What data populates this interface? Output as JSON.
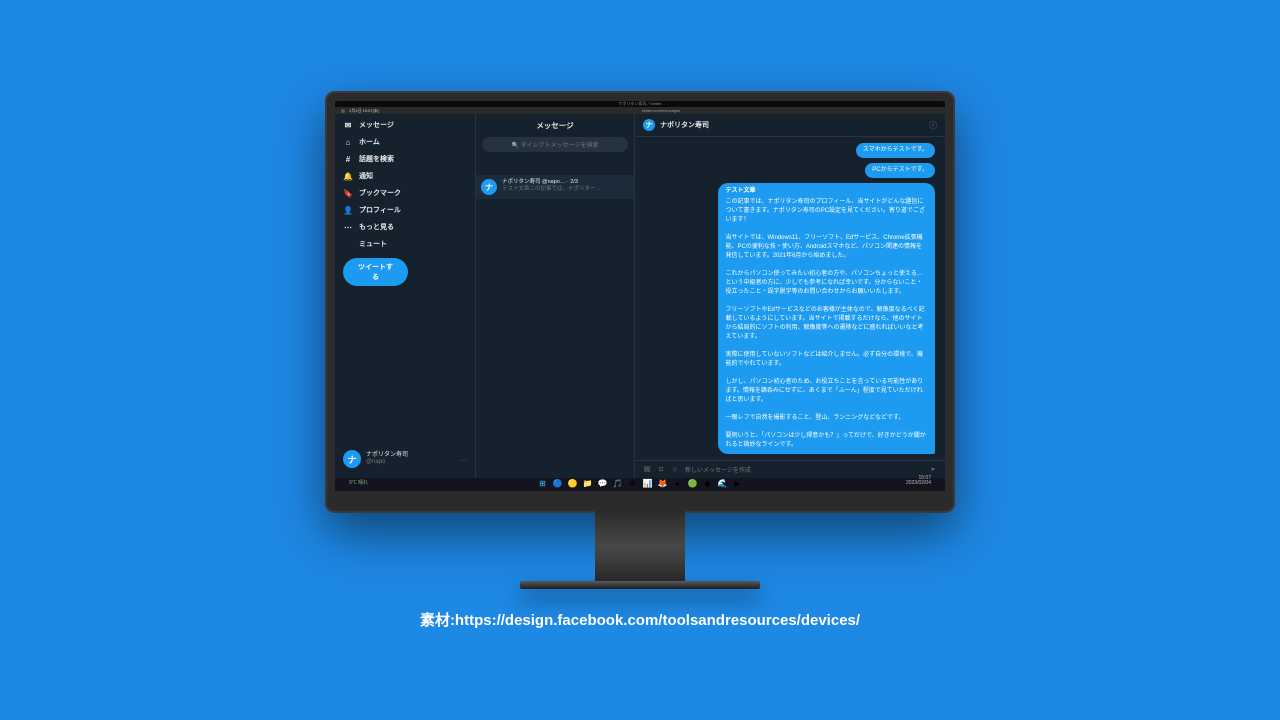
{
  "titlebar": {
    "text": "ナポリタン寿司 / Twitter"
  },
  "urlbar": {
    "left": "2月4日 15:07(未)",
    "url": "twitter.com/messages"
  },
  "sidebar": {
    "items": [
      {
        "icon": "✉",
        "label": "メッセージ"
      },
      {
        "icon": "⌂",
        "label": "ホーム"
      },
      {
        "icon": "#",
        "label": "話題を検索"
      },
      {
        "icon": "🔔",
        "label": "通知"
      },
      {
        "icon": "🔖",
        "label": "ブックマーク"
      },
      {
        "icon": "👤",
        "label": "プロフィール"
      },
      {
        "icon": "⋯",
        "label": "もっと見る"
      },
      {
        "icon": "",
        "label": "ミュート"
      }
    ],
    "tweet": "ツイートする",
    "user": {
      "name": "ナポリタン寿司",
      "handle": "@napo",
      "dots": "…"
    }
  },
  "conv_col": {
    "title": "メッセージ",
    "search": "🔍 ダイレクトメッセージを検索",
    "conv": {
      "line1": "ナポリタン寿司 @napo… · 2/3",
      "line2": "テスト文章この記事では、ナポリター…"
    }
  },
  "chat": {
    "header": "ナポリタン寿司",
    "m1": "スマホからテストです。",
    "m2": "PCからテストです。",
    "long_title": "テスト文章",
    "long_body": "この記事では、ナポリタン寿司のプロフィール、当サイトがどんな趣旨について書きます。ナポリタン寿司のPC設定を見てください。寄り道でございます！\n\n当サイトでは、Windows11、フリーソフト、Edサービス、Chrome拡張機能、PCの便利な技・使い方、Androidスマホなど、パソコン関連の情報を発信しています。2021年6月から始めました。\n\nこれからパソコン使ってみたい初心者の方や、パソコンちょっと使える…という中級者の方に、少しでも参考になれば幸いです。分からないこと・役立ったこと・誤字脱字等のお問い合わせからお願いいたします。\n\nフリーソフトやEdサービスなどのお客様が主体なので、解像度なるべく記載しているようにしています。当サイトで掲載するだけなら、他のサイトから結局的にソフトの利用、解像度等への遷移などに盛れればいいなと考えています。\n\n実際に使用していないソフトなどは紹介しません。必ず自分の環境で、機能的でやれています。\n\nしかし、パソコン初心者のため、お役立ちことを言っている可能性があります。情報を鵜呑みにせずに、あくまで「ふーん」程度で見ていただければと思います。\n\n一眼レフで自然を撮影すること、登山、ランニングなどなどです。\n\n要例いうと、「パソコンは少し得意かも？」ってだけで、好きかどうか聞かれると微妙なラインです。",
    "composer": {
      "placeholder": "新しいメッセージを作成",
      "send": "➤"
    }
  },
  "taskbar": {
    "time": "15:07",
    "date": "2023/02/04",
    "icons": [
      "⊞",
      "🔵",
      "🟡",
      "📁",
      "💬",
      "🎵",
      "⚙",
      "📊",
      "🦊",
      "●",
      "🟢",
      "◆",
      "🌊",
      "▶"
    ]
  },
  "sys": {
    "left": "9℃\n晴れ"
  },
  "credit": "素材:https://design.facebook.com/toolsandresources/devices/"
}
